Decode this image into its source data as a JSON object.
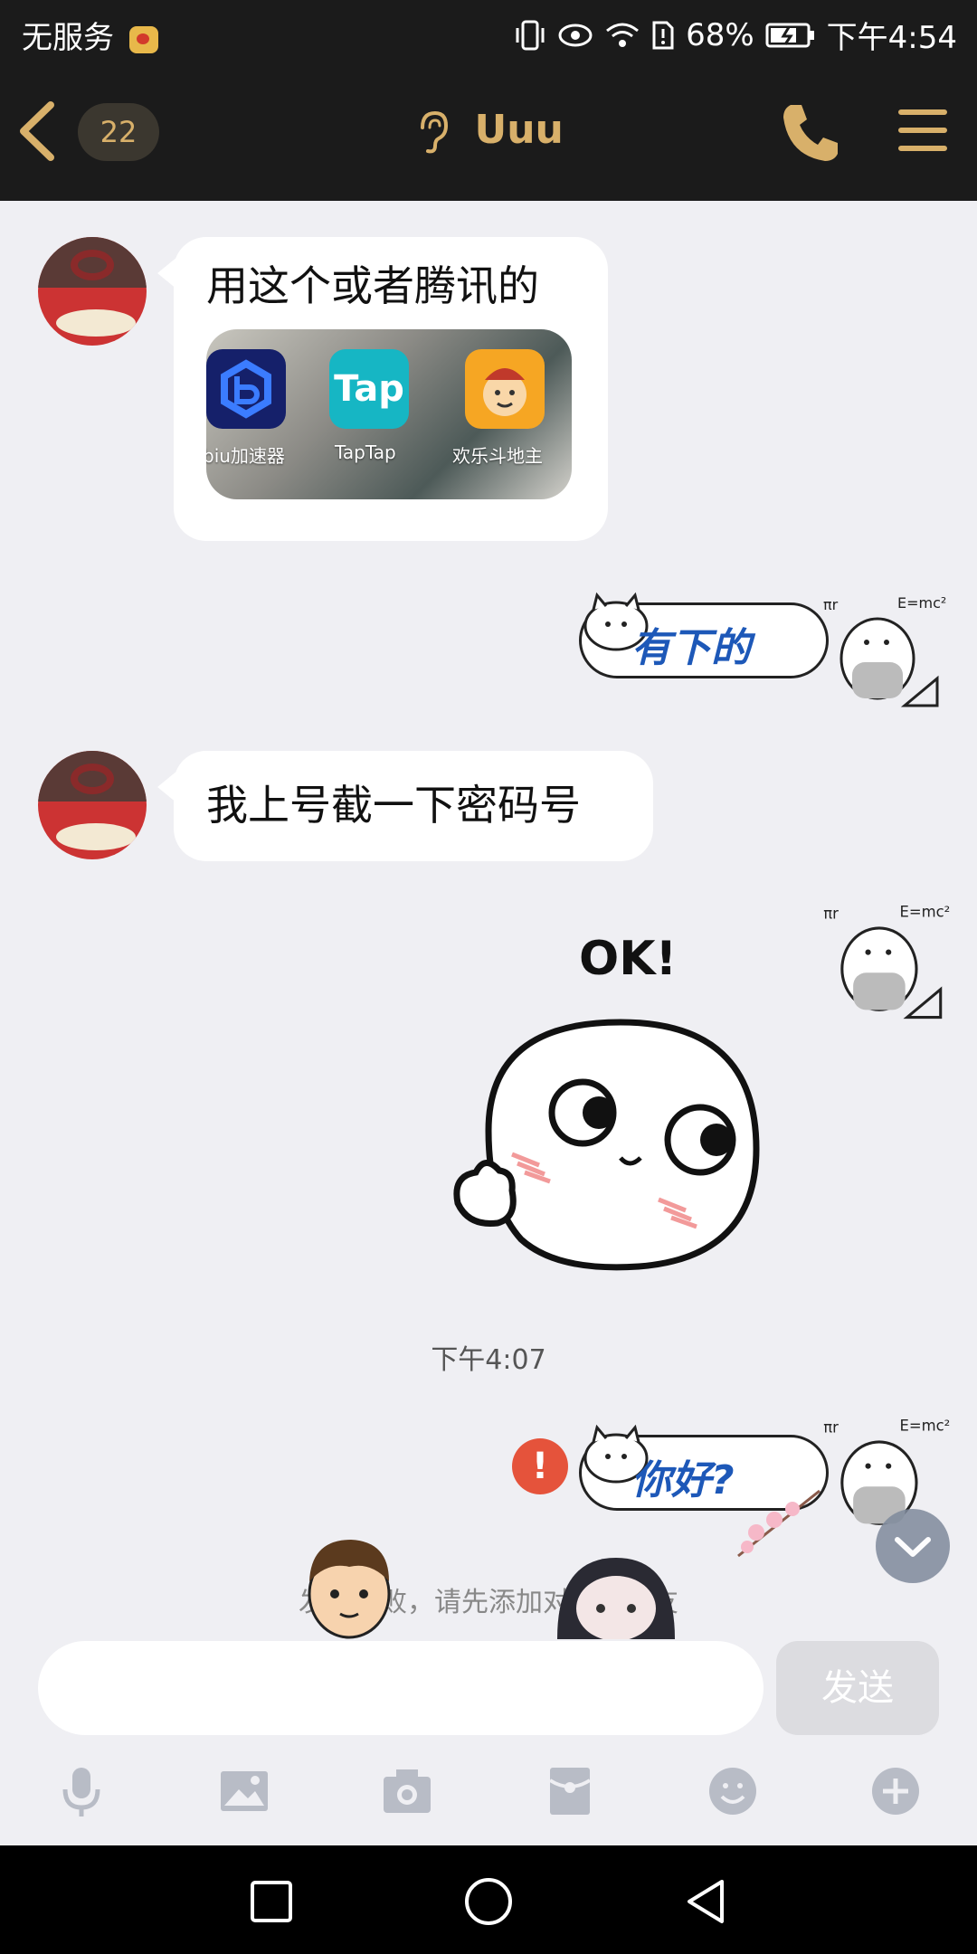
{
  "status_bar": {
    "carrier": "无服务",
    "battery": "68%",
    "time": "下午4:54"
  },
  "header": {
    "unread_count": "22",
    "title": "Uuu"
  },
  "messages": {
    "m1_text": "用这个或者腾讯的",
    "m1_apps": [
      {
        "label": "biu加速器"
      },
      {
        "label": "TapTap",
        "icon_text": "Tap"
      },
      {
        "label": "欢乐斗地主"
      }
    ],
    "sticker1_text": "有下的",
    "m2_text": "我上号截一下密码号",
    "ok_text": "OK!",
    "timestamp": "下午4:07",
    "sticker2_text": "你好?",
    "warning_mark": "!"
  },
  "system_tip": "发送失败，请先添加对方为好友",
  "composer": {
    "placeholder": "",
    "send_label": "发送"
  },
  "colors": {
    "accent_gold": "#d8b06a",
    "bar_dark": "#1b1b1b",
    "chat_bg": "#efeff3",
    "error_red": "#e5533b"
  },
  "icons": [
    "back-arrow-icon",
    "ear-icon",
    "phone-icon",
    "menu-icon",
    "mic-icon",
    "image-icon",
    "camera-icon",
    "red-packet-icon",
    "emoji-icon",
    "plus-icon",
    "recent-apps-icon",
    "home-icon",
    "back-triangle-icon"
  ]
}
